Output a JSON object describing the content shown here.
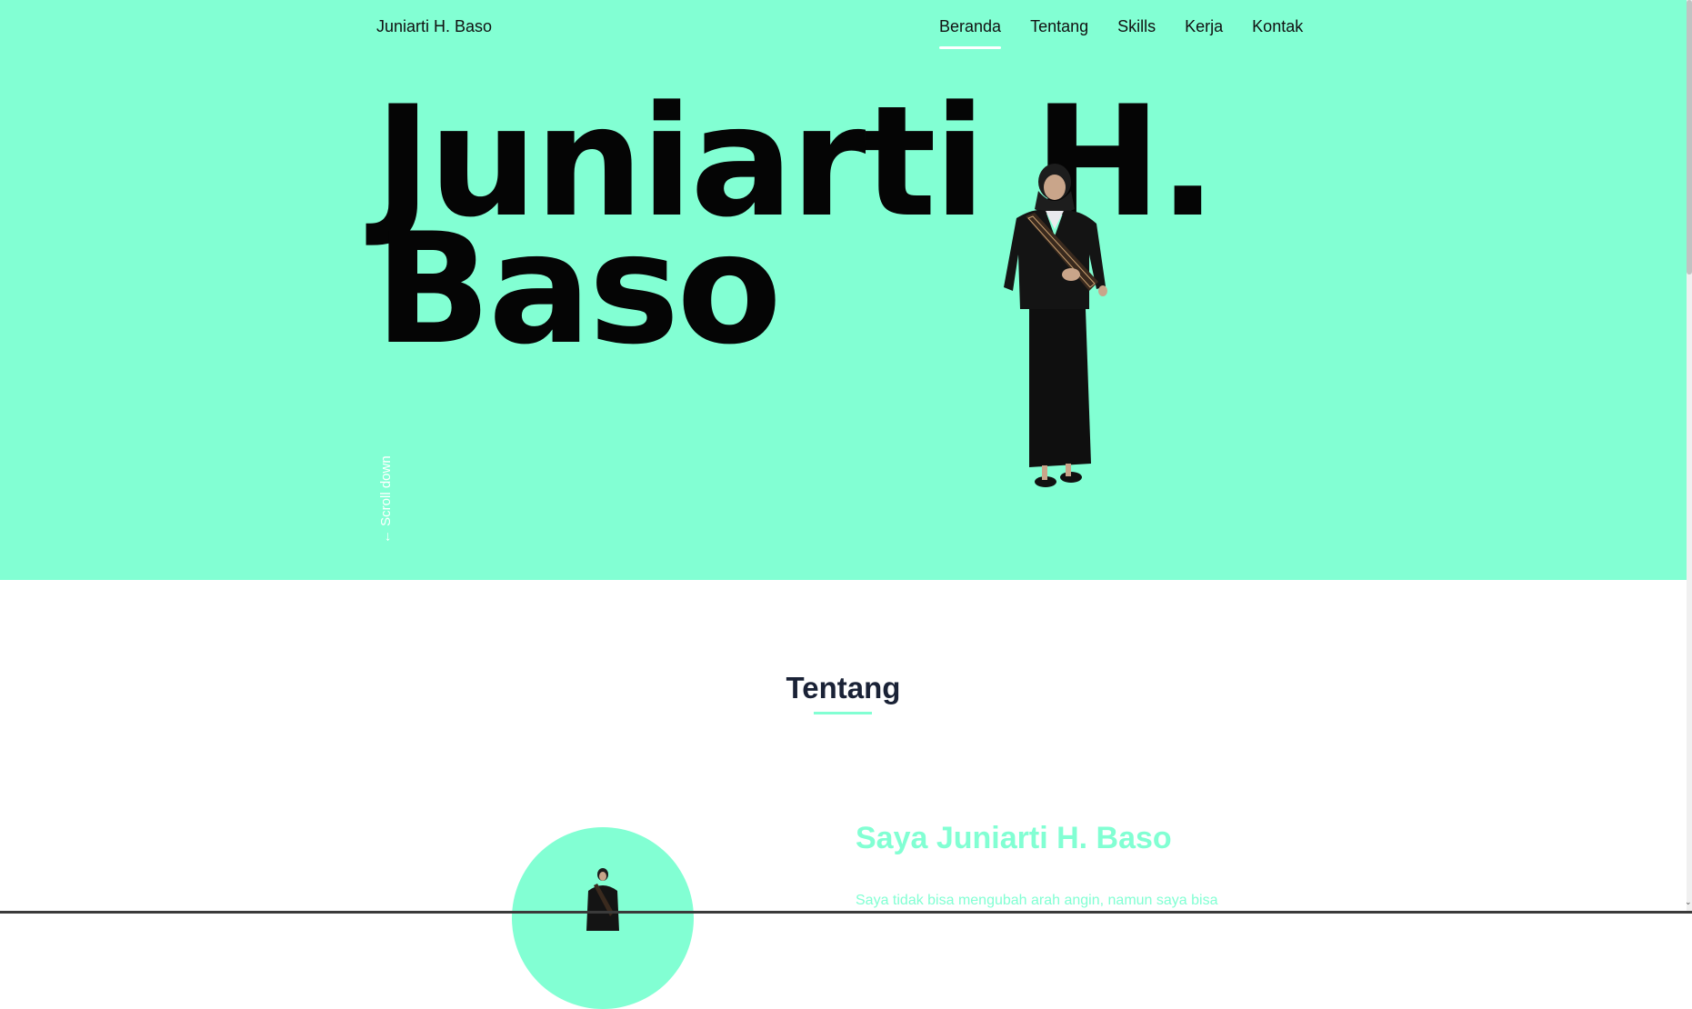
{
  "header": {
    "logo": "Juniarti H. Baso",
    "nav": [
      {
        "label": "Beranda",
        "active": true
      },
      {
        "label": "Tentang",
        "active": false
      },
      {
        "label": "Skills",
        "active": false
      },
      {
        "label": "Kerja",
        "active": false
      },
      {
        "label": "Kontak",
        "active": false
      }
    ]
  },
  "hero": {
    "title_line1": "Juniarti H.",
    "title_line2": "Baso",
    "scroll_label": "← Scroll down",
    "background_color": "#82ffd3"
  },
  "about": {
    "section_title": "Tentang",
    "heading": "Saya Juniarti H. Baso",
    "text": "Saya tidak bisa mengubah arah angin, namun saya bisa"
  },
  "colors": {
    "accent": "#82ffd3",
    "heading_dark": "#1a2236",
    "text_black": "#050505"
  }
}
